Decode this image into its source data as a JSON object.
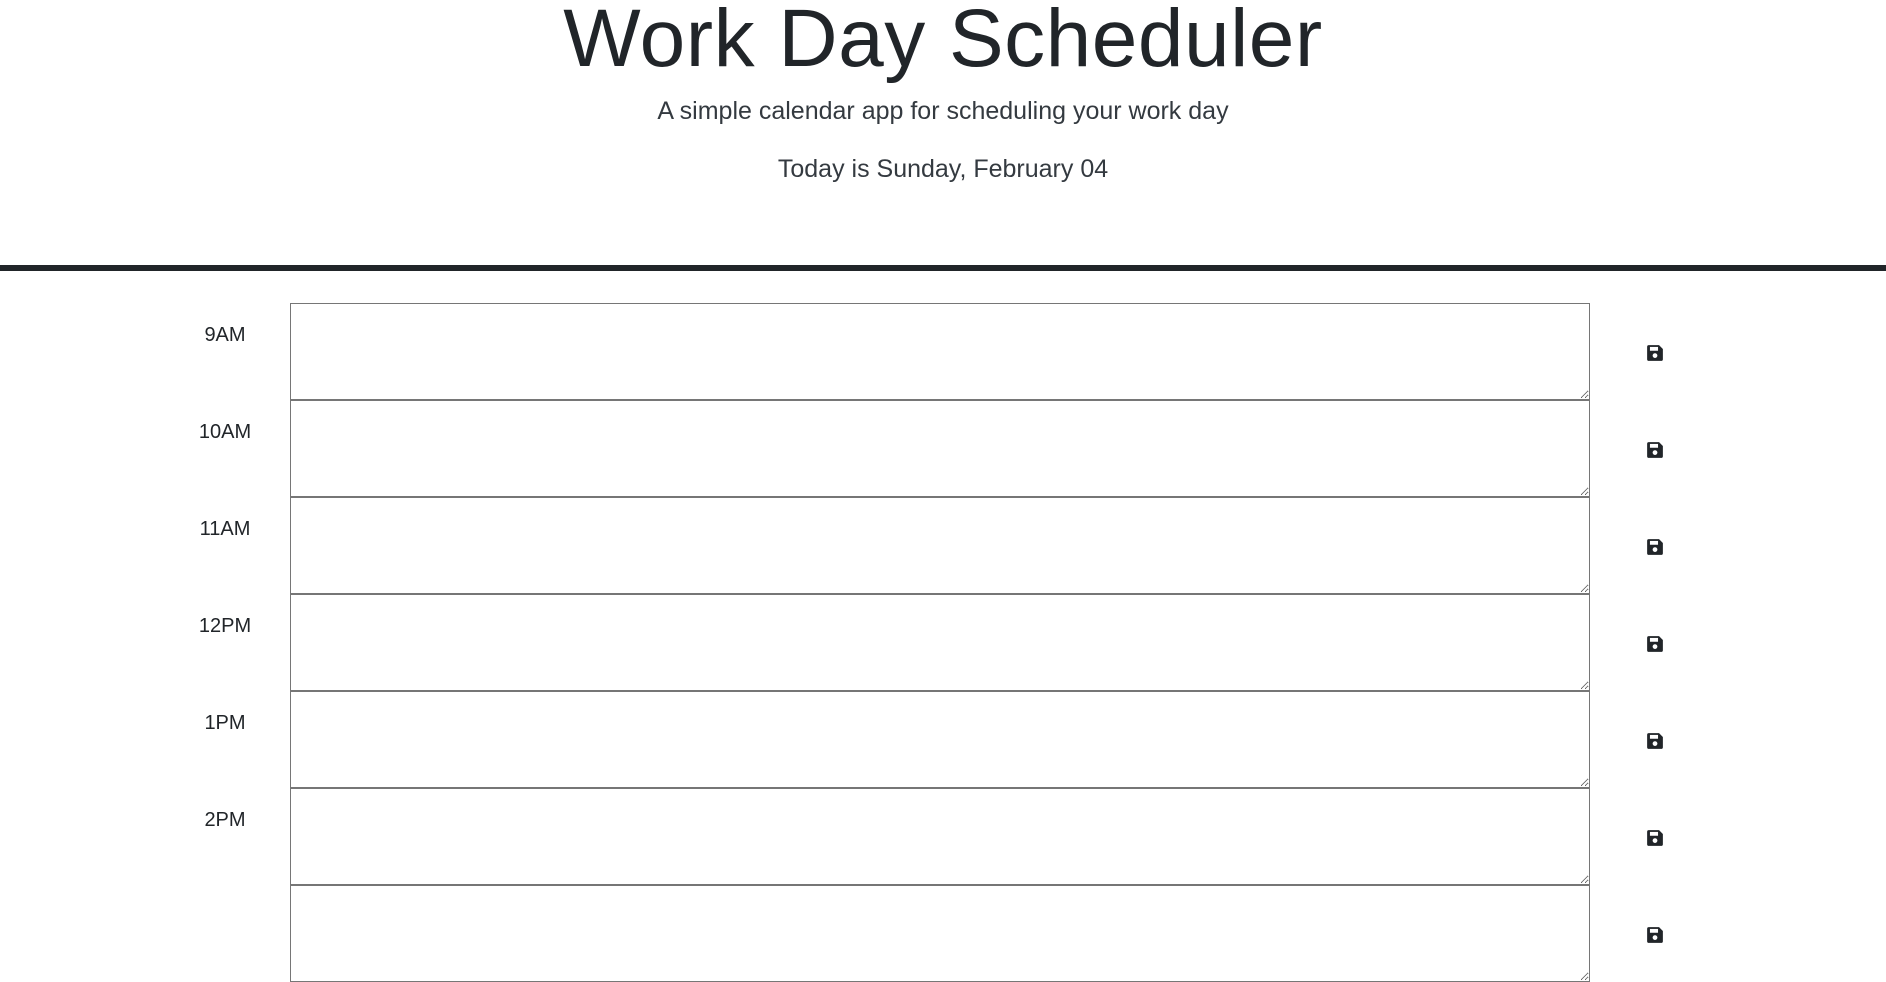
{
  "header": {
    "title": "Work Day Scheduler",
    "subtitle": "A simple calendar app for scheduling your work day",
    "current_day": "Today is Sunday, February 04"
  },
  "timeblocks": [
    {
      "hour": "9AM",
      "text": "",
      "save_icon": "floppy-disk-icon"
    },
    {
      "hour": "10AM",
      "text": "",
      "save_icon": "floppy-disk-icon"
    },
    {
      "hour": "11AM",
      "text": "",
      "save_icon": "floppy-disk-icon"
    },
    {
      "hour": "12PM",
      "text": "",
      "save_icon": "floppy-disk-icon"
    },
    {
      "hour": "1PM",
      "text": "",
      "save_icon": "floppy-disk-icon"
    },
    {
      "hour": "2PM",
      "text": "",
      "save_icon": "floppy-disk-icon"
    },
    {
      "hour": "",
      "text": "",
      "save_icon": "floppy-disk-icon"
    }
  ],
  "colors": {
    "text": "#212529",
    "divider": "#212529",
    "textarea_border": "#767676",
    "background": "#ffffff"
  }
}
